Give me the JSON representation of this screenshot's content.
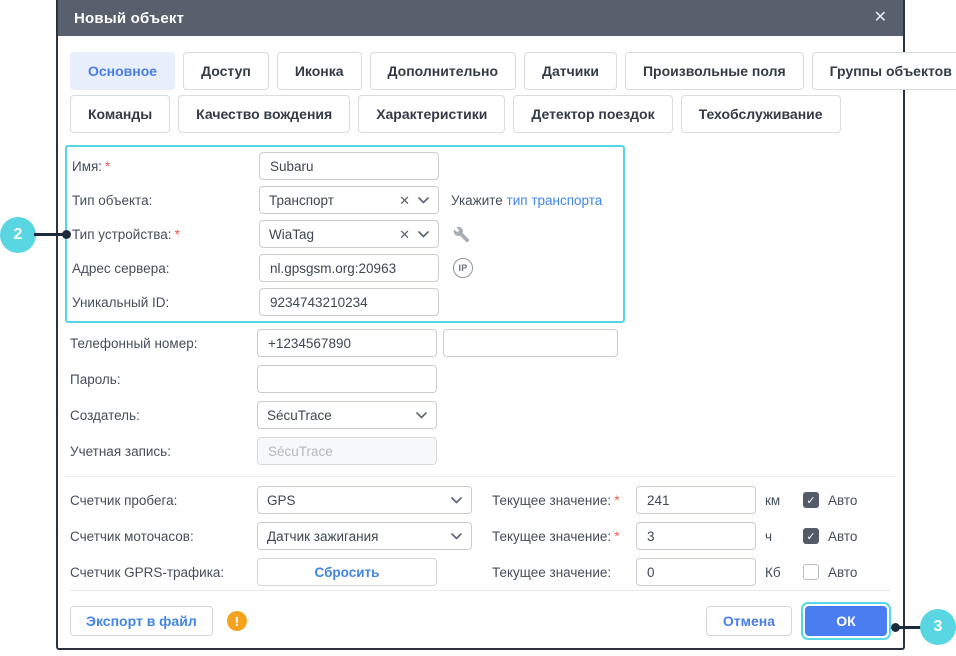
{
  "dialog": {
    "title": "Новый объект",
    "close_icon": "✕"
  },
  "tabs": {
    "items": [
      {
        "label": "Основное",
        "active": true
      },
      {
        "label": "Доступ",
        "active": false
      },
      {
        "label": "Иконка",
        "active": false
      },
      {
        "label": "Дополнительно",
        "active": false
      },
      {
        "label": "Датчики",
        "active": false
      },
      {
        "label": "Произвольные поля",
        "active": false
      },
      {
        "label": "Группы объектов",
        "active": false
      },
      {
        "label": "Команды",
        "active": false
      },
      {
        "label": "Качество вождения",
        "active": false
      },
      {
        "label": "Характеристики",
        "active": false
      },
      {
        "label": "Детектор поездок",
        "active": false
      },
      {
        "label": "Техобслуживание",
        "active": false
      }
    ]
  },
  "form": {
    "name": {
      "label": "Имя:",
      "star": "*",
      "value": "Subaru"
    },
    "object_type": {
      "label": "Тип объекта:",
      "value": "Транспорт",
      "clear_icon": "✕",
      "hint_prefix": "Укажите ",
      "hint_link": "тип транспорта"
    },
    "device_type": {
      "label": "Тип устройства:",
      "star": "*",
      "value": "WiaTag",
      "clear_icon": "✕"
    },
    "server_address": {
      "label": "Адрес сервера:",
      "value": "nl.gpsgsm.org:20963",
      "ip_icon": "IP"
    },
    "unique_id": {
      "label": "Уникальный ID:",
      "value": "9234743210234"
    },
    "phone": {
      "label": "Телефонный номер:",
      "value": "+1234567890",
      "value2": ""
    },
    "password": {
      "label": "Пароль:",
      "value": ""
    },
    "creator": {
      "label": "Создатель:",
      "value": "SécuTrace"
    },
    "account": {
      "label": "Учетная запись:",
      "value": "SécuTrace"
    }
  },
  "counters": {
    "mileage": {
      "label": "Счетчик пробега:",
      "source": "GPS",
      "current_label": "Текущее значение:",
      "star": "*",
      "value": "241",
      "unit": "км",
      "auto_label": "Авто",
      "auto_checked": true,
      "check_icon": "✓"
    },
    "engine_hours": {
      "label": "Счетчик моточасов:",
      "source": "Датчик зажигания",
      "current_label": "Текущее значение:",
      "star": "*",
      "value": "3",
      "unit": "ч",
      "auto_label": "Авто",
      "auto_checked": true,
      "check_icon": "✓"
    },
    "gprs": {
      "label": "Счетчик GPRS-трафика:",
      "reset_label": "Сбросить",
      "current_label": "Текущее значение:",
      "value": "0",
      "unit": "Кб",
      "auto_label": "Авто",
      "auto_checked": false,
      "check_icon": "✓"
    }
  },
  "footer": {
    "export_label": "Экспорт в файл",
    "warning_icon": "!",
    "cancel_label": "Отмена",
    "ok_label": "ОК"
  },
  "callouts": {
    "left": "2",
    "right": "3"
  },
  "colors": {
    "accent_blue": "#4a7df0",
    "accent_cyan": "#57d7e4",
    "header": "#57606c",
    "warning_orange": "#f5a31e",
    "required_red": "#f25b51",
    "link_blue": "#4285e8"
  }
}
